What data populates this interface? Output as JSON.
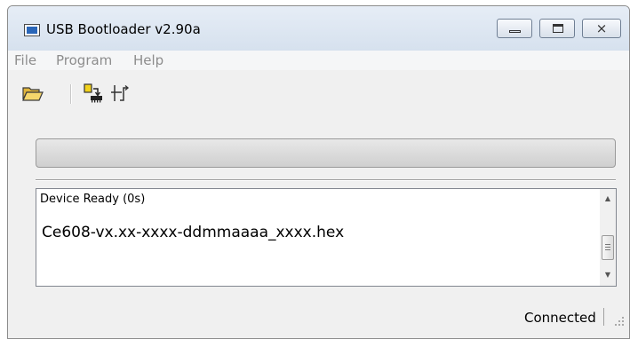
{
  "window": {
    "title": "USB Bootloader v2.90a",
    "close_glyph": "⨯"
  },
  "menu": {
    "items": [
      "File",
      "Program",
      "Help"
    ]
  },
  "toolbar": {
    "icons": [
      "open-folder-icon",
      "program-device-icon",
      "reset-device-icon"
    ]
  },
  "progress": {
    "percent": 0
  },
  "log": {
    "status_line": "Device Ready (0s)",
    "file_line": "Ce608-vx.xx-xxxx-ddmmaaaa_xxxx.hex",
    "scroll_up_glyph": "▲",
    "scroll_down_glyph": "▼"
  },
  "statusbar": {
    "text": "Connected"
  },
  "colors": {
    "accent": "#2a66b8",
    "folder": "#e0b43a",
    "chip": "#f2d21c"
  }
}
